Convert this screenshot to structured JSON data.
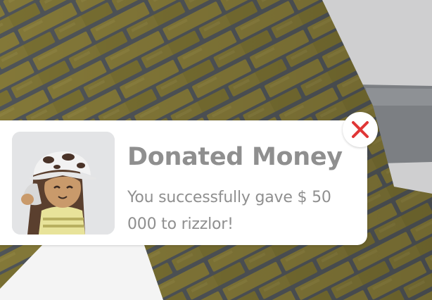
{
  "notification": {
    "title": "Donated Money",
    "message": "You successfully gave $ 50 000 to rizzlor!",
    "avatar_icon": "player-avatar",
    "close_icon": "close-x-icon"
  },
  "colors": {
    "text": "#8f8f8f",
    "card": "#ffffff",
    "avatar_bg": "#e3e4e6",
    "close": "#e03636",
    "brick": "#867b39",
    "mortar": "#53585c"
  }
}
